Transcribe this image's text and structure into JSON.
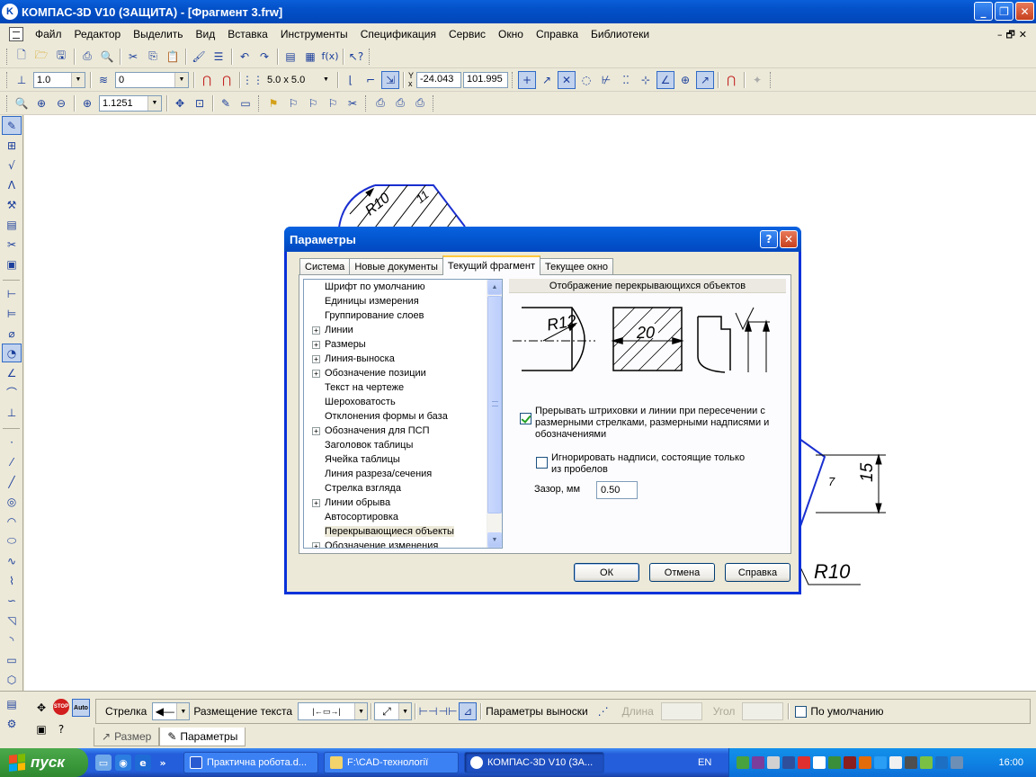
{
  "window": {
    "title": "КОМПАС-3D V10 (ЗАЩИТА) - [Фрагмент 3.frw]",
    "icon": "kompas-logo-icon"
  },
  "menu": [
    "Файл",
    "Редактор",
    "Выделить",
    "Вид",
    "Вставка",
    "Инструменты",
    "Спецификация",
    "Сервис",
    "Окно",
    "Справка",
    "Библиотеки"
  ],
  "toolbar": {
    "line_scale": "1.0",
    "layer": "0",
    "grid_step": "5.0 x 5.0",
    "coord_x_label": "Y",
    "coord_y_label": "x",
    "coord_x": "-24.043",
    "coord_y": "101.995",
    "zoom": "1.1251"
  },
  "drawing": {
    "dim_radius_top": "R10",
    "hatch_label": "11",
    "dim_15": "15",
    "dim_r10": "R10",
    "mark_7": "7"
  },
  "dialog": {
    "title": "Параметры",
    "tabs": [
      "Система",
      "Новые документы",
      "Текущий фрагмент",
      "Текущее окно"
    ],
    "active_tab": 2,
    "tree": [
      {
        "label": "Шрифт по умолчанию",
        "expandable": false
      },
      {
        "label": "Единицы измерения",
        "expandable": false
      },
      {
        "label": "Группирование слоев",
        "expandable": false
      },
      {
        "label": "Линии",
        "expandable": true
      },
      {
        "label": "Размеры",
        "expandable": true
      },
      {
        "label": "Линия-выноска",
        "expandable": true
      },
      {
        "label": "Обозначение позиции",
        "expandable": true
      },
      {
        "label": "Текст на чертеже",
        "expandable": false
      },
      {
        "label": "Шероховатость",
        "expandable": false
      },
      {
        "label": "Отклонения формы и база",
        "expandable": false
      },
      {
        "label": "Обозначения для ПСП",
        "expandable": true
      },
      {
        "label": "Заголовок таблицы",
        "expandable": false
      },
      {
        "label": "Ячейка таблицы",
        "expandable": false
      },
      {
        "label": "Линия разреза/сечения",
        "expandable": false
      },
      {
        "label": "Стрелка взгляда",
        "expandable": false
      },
      {
        "label": "Линии обрыва",
        "expandable": true
      },
      {
        "label": "Автосортировка",
        "expandable": false
      },
      {
        "label": "Перекрывающиеся объекты",
        "expandable": false,
        "selected": true
      },
      {
        "label": "Обозначение изменения",
        "expandable": true
      }
    ],
    "page_title": "Отображение перекрывающихся объектов",
    "preview": {
      "r_label": "R12",
      "dim_label": "20"
    },
    "opt_break": {
      "label": "Прерывать штриховки и линии при пересечении с размерными стрелками, размерными надписями и обозначениями",
      "checked": true
    },
    "opt_ignore": {
      "label": "Игнорировать надписи, состоящие только из пробелов",
      "checked": false
    },
    "gap_label": "Зазор, мм",
    "gap_value": "0.50",
    "buttons": {
      "ok": "ОК",
      "cancel": "Отмена",
      "help": "Справка"
    }
  },
  "props": {
    "arrow_label": "Стрелка",
    "placement_label": "Размещение текста",
    "leader_label": "Параметры выноски",
    "length_label": "Длина",
    "angle_label": "Угол",
    "default_label": "По умолчанию",
    "tab_size": "Размер",
    "tab_params": "Параметры",
    "stop_label": "STOP",
    "auto_label": "Auto"
  },
  "taskbar": {
    "start": "пуск",
    "tasks": [
      {
        "label": "Практична робота.d...",
        "icon": "word-doc-icon",
        "active": false
      },
      {
        "label": "F:\\CAD-технології",
        "icon": "folder-icon",
        "active": false
      },
      {
        "label": "КОМПАС-3D V10 (ЗА...",
        "icon": "kompas-logo-icon",
        "active": true
      }
    ],
    "lang": "EN",
    "time": "16:00"
  },
  "colors": {
    "accent": "#0831d9",
    "drawing_blue": "#1a2fd0",
    "canvas": "#ffffff",
    "ui_face": "#ece9d8"
  }
}
